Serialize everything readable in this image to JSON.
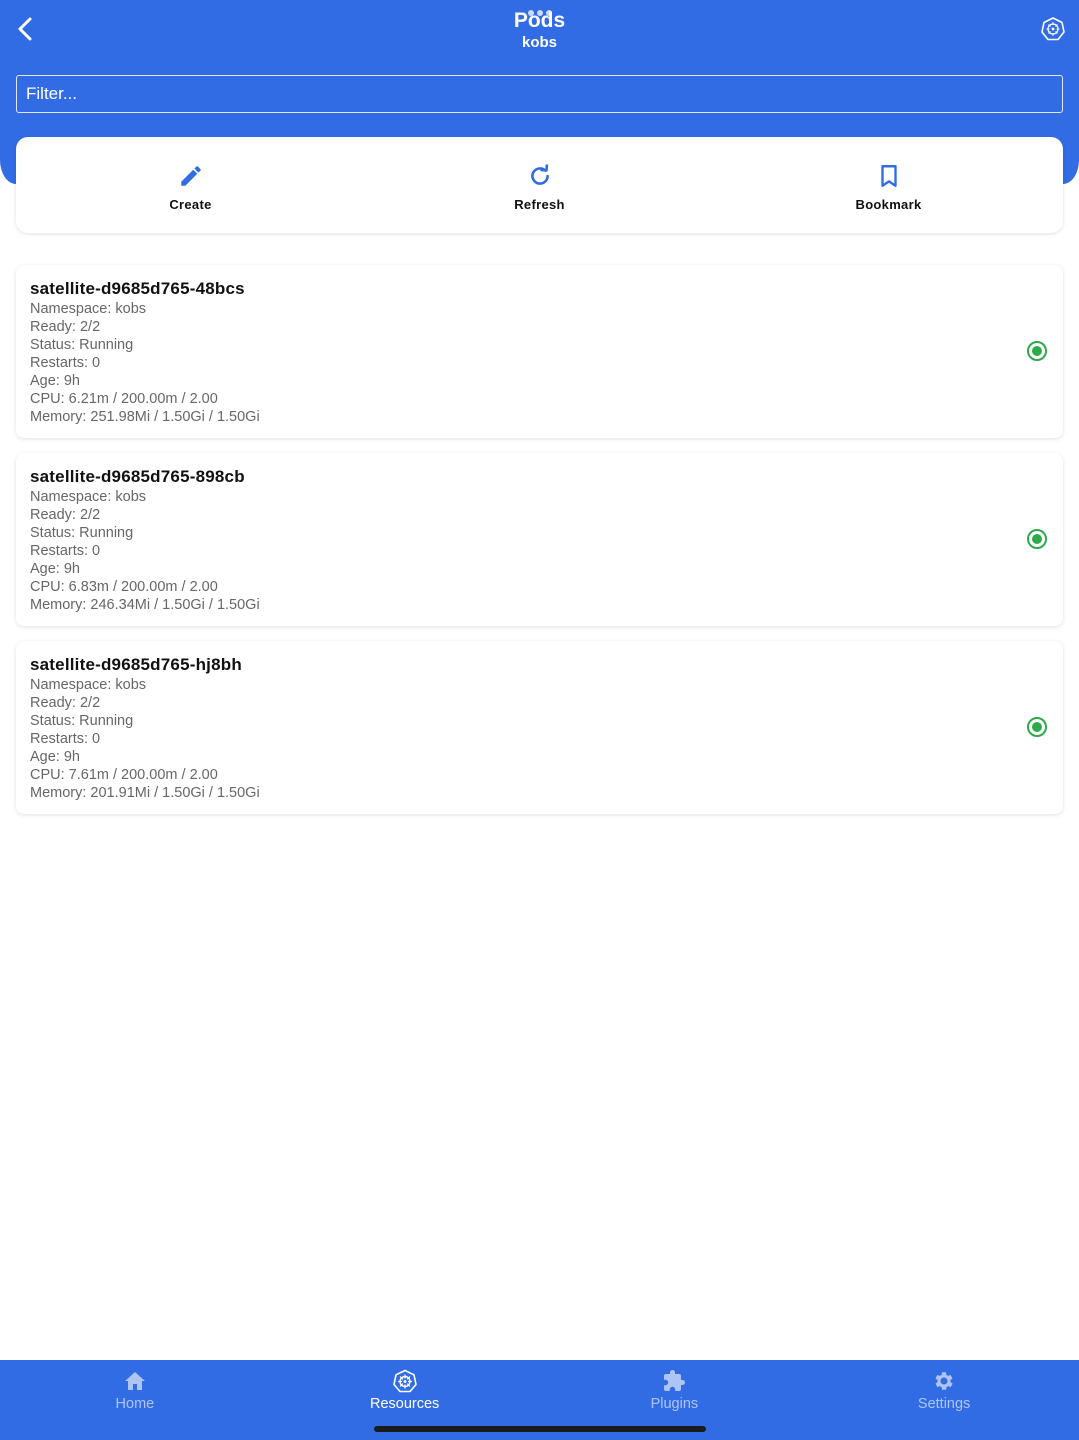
{
  "header": {
    "title": "Pods",
    "subtitle": "kobs",
    "back_icon": "chevron-left-icon",
    "cluster_icon": "kubernetes-cluster-icon",
    "background_color": "#326ce5"
  },
  "filter": {
    "placeholder": "Filter...",
    "value": ""
  },
  "actions": [
    {
      "label": "Create",
      "icon": "pencil-icon"
    },
    {
      "label": "Refresh",
      "icon": "refresh-icon"
    },
    {
      "label": "Bookmark",
      "icon": "bookmark-icon"
    }
  ],
  "pods": [
    {
      "name": "satellite-d9685d765-48bcs",
      "namespace": "Namespace: kobs",
      "ready": "Ready: 2/2",
      "status": "Status: Running",
      "restarts": "Restarts: 0",
      "age": "Age: 9h",
      "cpu": "CPU: 6.21m / 200.00m / 2.00",
      "memory": "Memory: 251.98Mi / 1.50Gi / 1.50Gi",
      "status_color": "#2ea94b"
    },
    {
      "name": "satellite-d9685d765-898cb",
      "namespace": "Namespace: kobs",
      "ready": "Ready: 2/2",
      "status": "Status: Running",
      "restarts": "Restarts: 0",
      "age": "Age: 9h",
      "cpu": "CPU: 6.83m / 200.00m / 2.00",
      "memory": "Memory: 246.34Mi / 1.50Gi / 1.50Gi",
      "status_color": "#2ea94b"
    },
    {
      "name": "satellite-d9685d765-hj8bh",
      "namespace": "Namespace: kobs",
      "ready": "Ready: 2/2",
      "status": "Status: Running",
      "restarts": "Restarts: 0",
      "age": "Age: 9h",
      "cpu": "CPU: 7.61m / 200.00m / 2.00",
      "memory": "Memory: 201.91Mi / 1.50Gi / 1.50Gi",
      "status_color": "#2ea94b"
    }
  ],
  "tabbar": {
    "items": [
      {
        "label": "Home",
        "icon": "home-icon",
        "active": false
      },
      {
        "label": "Resources",
        "icon": "kubernetes-wheel-icon",
        "active": true
      },
      {
        "label": "Plugins",
        "icon": "puzzle-icon",
        "active": false
      },
      {
        "label": "Settings",
        "icon": "gear-icon",
        "active": false
      }
    ]
  }
}
